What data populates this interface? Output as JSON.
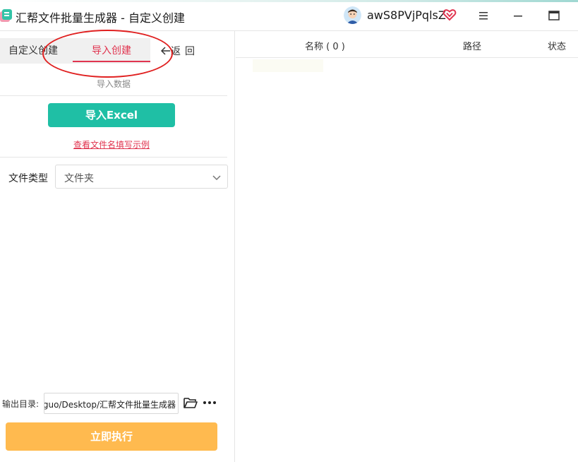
{
  "window": {
    "title": "汇帮文件批量生成器 - 自定义创建",
    "username": "awS8PVjPqlsZ",
    "icons": {
      "logo": "app-logo-icon",
      "vip": "vip-heart-icon",
      "menu": "menu-icon",
      "minimize": "minimize-icon",
      "maximize": "maximize-icon"
    }
  },
  "tabs": {
    "custom": "自定义创建",
    "import": "导入创建",
    "back": "返回"
  },
  "import_section": {
    "label": "导入数据",
    "import_button": "导入Excel",
    "example_link": "查看文件名填写示例"
  },
  "file_type": {
    "label": "文件类型",
    "selected": "文件夹"
  },
  "output": {
    "label": "输出目录:",
    "path": "guo/Desktop/汇帮文件批量生成器"
  },
  "execute_button": "立即执行",
  "table": {
    "columns": {
      "name": "名称 ( 0 )",
      "path": "路径",
      "status": "状态"
    }
  },
  "colors": {
    "accent_teal": "#1fbfa5",
    "accent_red": "#e0344f",
    "execute_orange": "#ffba4f",
    "annotation_red": "#e02020"
  }
}
